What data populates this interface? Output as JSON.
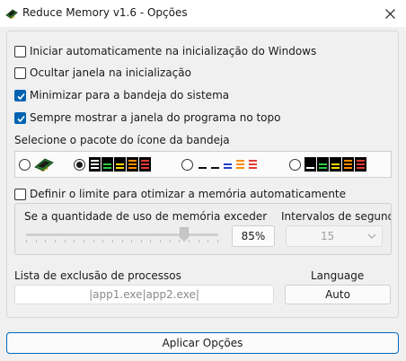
{
  "window": {
    "title": "Reduce Memory v1.6 - Opções",
    "app_icon": "memory-chip-icon",
    "close_icon": "close-icon"
  },
  "options": {
    "autostart": {
      "label": "Iniciar automaticamente na inicialização do Windows",
      "checked": false
    },
    "hide_on_start": {
      "label": "Ocultar janela na inicialização",
      "checked": false
    },
    "minimize_to_tray": {
      "label": "Minimizar para a bandeja do sistema",
      "checked": true
    },
    "always_on_top": {
      "label": "Sempre mostrar a janela do programa no topo",
      "checked": true
    }
  },
  "icon_pack": {
    "label": "Selecione o pacote do ícone da bandeja",
    "selected_index": 1,
    "packs": [
      "chip-icon-pack",
      "colored-bars-black-pack",
      "colored-bars-white-pack",
      "colored-bars-black-alt-pack"
    ]
  },
  "auto_limit": {
    "checkbox_label": "Definir o limite para otimizar a memória automaticamente",
    "checked": false,
    "threshold_label": "Se a quantidade de uso de memória exceder",
    "threshold_value": "85%",
    "threshold_fraction": 0.85,
    "interval_label": "Intervalos de segundo",
    "interval_value": "15",
    "interval_disabled": true
  },
  "exclusion": {
    "label": "Lista de exclusão de processos",
    "value": "|app1.exe|app2.exe|"
  },
  "language": {
    "label": "Language",
    "value": "Auto"
  },
  "apply_button": "Aplicar Opções",
  "colors": {
    "accent": "#0063b1",
    "apply_border": "#0067c0"
  }
}
